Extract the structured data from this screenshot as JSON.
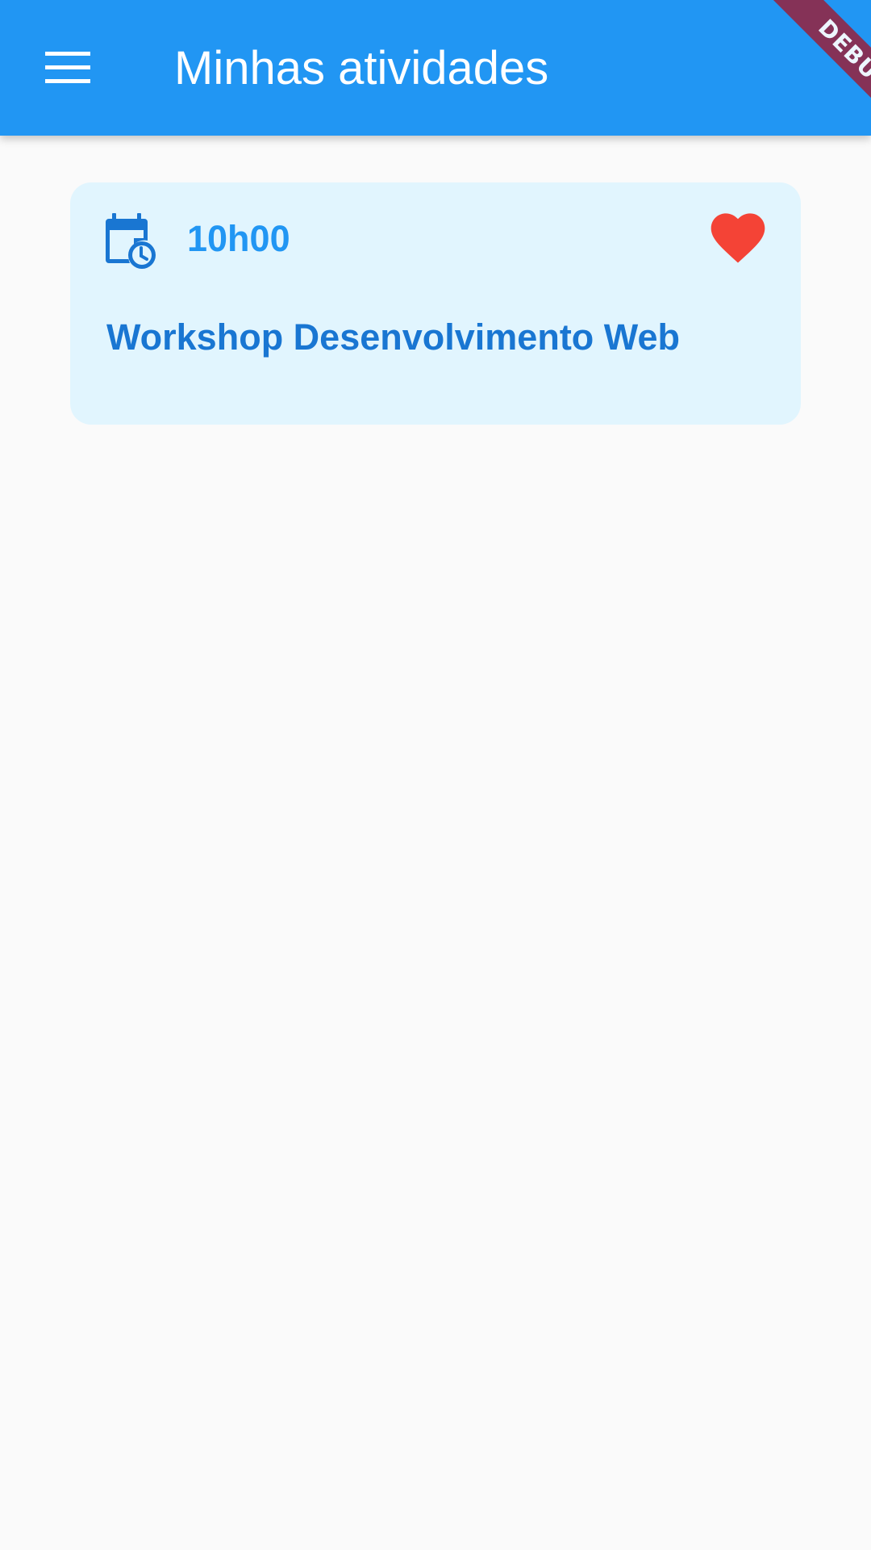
{
  "app_bar": {
    "title": "Minhas atividades",
    "background_color": "#2196f3",
    "menu_icon": "menu-icon",
    "debug_label": "DEBUG"
  },
  "activities": [
    {
      "time": "10h00",
      "title": "Workshop Desenvolvimento Web",
      "calendar_icon": "calendar-clock-icon",
      "favorite_icon": "heart-icon",
      "favorited": true,
      "card_color": "#e1f5fe",
      "accent_color": "#2196f3",
      "favorite_color": "#f44336"
    }
  ]
}
